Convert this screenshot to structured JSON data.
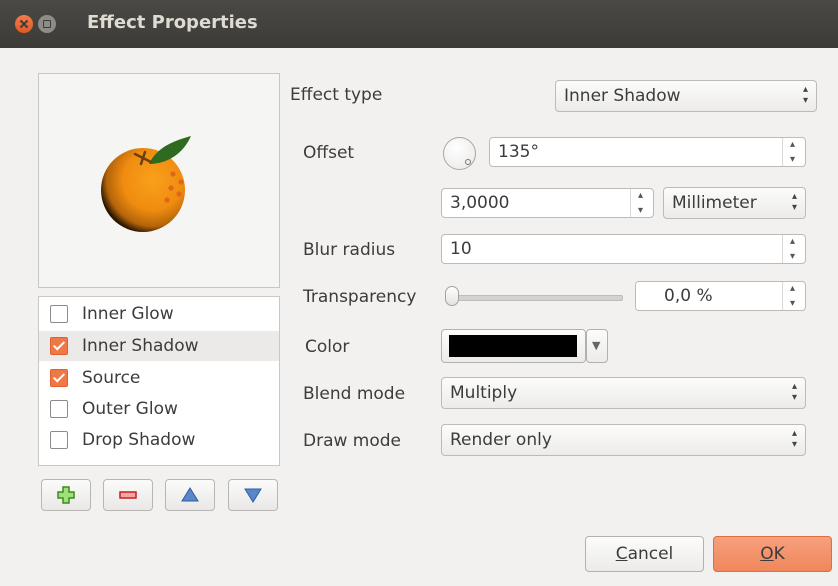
{
  "window": {
    "title": "Effect Properties"
  },
  "effects": [
    {
      "label": "Inner Glow",
      "checked": false,
      "selected": false
    },
    {
      "label": "Inner Shadow",
      "checked": true,
      "selected": true
    },
    {
      "label": "Source",
      "checked": true,
      "selected": false
    },
    {
      "label": "Outer Glow",
      "checked": false,
      "selected": false
    },
    {
      "label": "Drop Shadow",
      "checked": false,
      "selected": false
    }
  ],
  "list_buttons": [
    "add-effect-icon",
    "remove-effect-icon",
    "move-up-icon",
    "move-down-icon"
  ],
  "form": {
    "effect_type_label": "Effect type",
    "effect_type_value": "Inner Shadow",
    "offset_label": "Offset",
    "offset_angle": "135°",
    "offset_distance": "3,0000",
    "offset_unit": "Millimeter",
    "blur_label": "Blur radius",
    "blur_value": "10",
    "transparency_label": "Transparency",
    "transparency_value": "0,0 %",
    "transparency_level": 0,
    "color_label": "Color",
    "color_value": "#000000",
    "blend_label": "Blend mode",
    "blend_value": "Multiply",
    "draw_label": "Draw mode",
    "draw_value": "Render only"
  },
  "buttons": {
    "cancel_mnemonic": "C",
    "cancel_rest": "ancel",
    "ok_mnemonic": "O",
    "ok_rest": "K"
  },
  "colors": {
    "accent": "#f07746",
    "ok_button": "#f0875c",
    "titlebar": "#3c3b37",
    "close_button": "#e95e28"
  }
}
